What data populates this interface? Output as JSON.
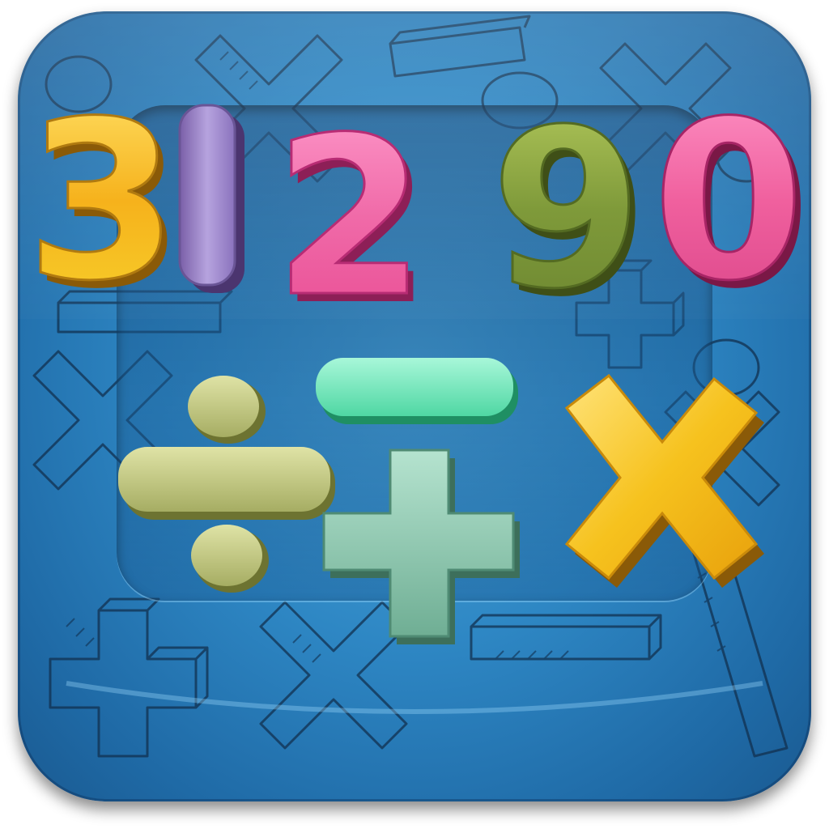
{
  "app_icon": {
    "title_digits": [
      "3",
      "1",
      "2",
      "9",
      "0"
    ],
    "operator_icons": [
      "divide-icon",
      "minus-icon",
      "plus-icon",
      "multiply-icon"
    ],
    "colors": {
      "tile_blue": "#2e87c4",
      "digit_3": "#f6b21c",
      "digit_1": "#9d86c9",
      "digit_2": "#f06aa8",
      "digit_9": "#7f9a3a",
      "digit_0": "#f0609e",
      "divide": "#b9c27d",
      "minus": "#6fe6b9",
      "plus": "#8ec9b0",
      "multiply": "#f6c21e"
    }
  }
}
